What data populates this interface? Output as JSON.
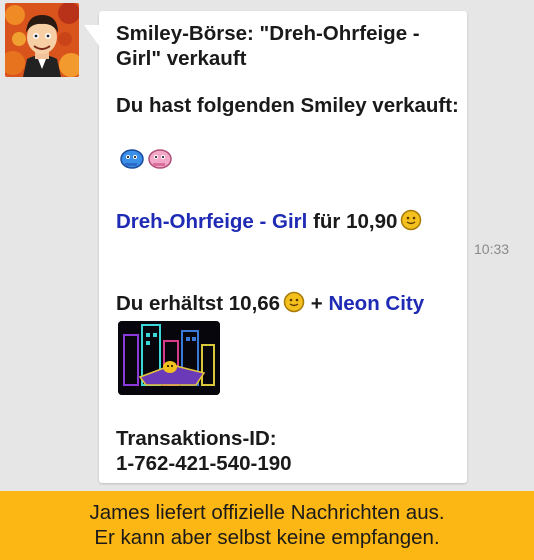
{
  "message": {
    "title": "Smiley-Börse: \"Dreh-Ohrfeige - Girl\" verkauft",
    "sold_text": "Du hast folgenden Smiley verkauft:",
    "offer": {
      "smiley_name": "Dreh-Ohrfeige - Girl",
      "for_label": "für",
      "price": "10,90"
    },
    "receive": {
      "text": "Du erhältst 10,66",
      "plus": "+",
      "item_name": "Neon City"
    },
    "transaction_label": "Transaktions-ID:",
    "transaction_id": "1-762-421-540-190",
    "time": "10:33"
  },
  "banner": {
    "line1": "James liefert offizielle Nachrichten aus.",
    "line2": "Er kann aber selbst keine empfangen."
  },
  "colors": {
    "link": "#1f2bb5",
    "banner": "#fdb714",
    "background": "#e6e6e6"
  }
}
